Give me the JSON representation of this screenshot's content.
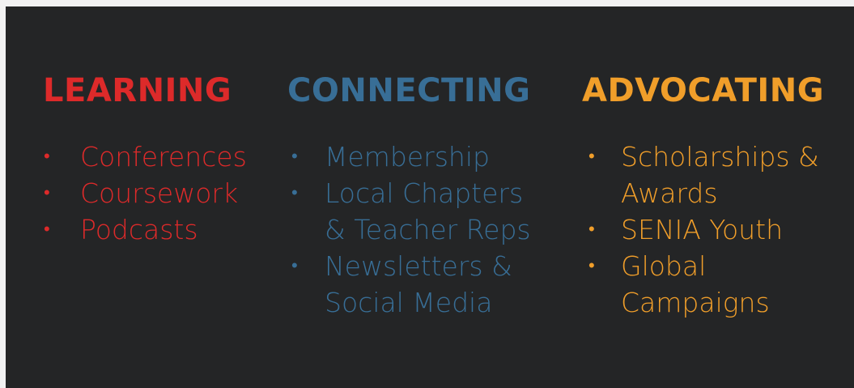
{
  "colors": {
    "background": "#242526",
    "page": "#f2f2f2",
    "learning": "#dd2a2a",
    "connecting": "#386e96",
    "advocating": "#f09e2a"
  },
  "columns": [
    {
      "heading": "LEARNING",
      "items": [
        [
          "Conferences"
        ],
        [
          "Coursework"
        ],
        [
          "Podcasts"
        ]
      ]
    },
    {
      "heading": "CONNECTING",
      "items": [
        [
          "Membership"
        ],
        [
          "Local Chapters",
          "& Teacher Reps"
        ],
        [
          "Newsletters &",
          "Social Media"
        ]
      ]
    },
    {
      "heading": "ADVOCATING",
      "items": [
        [
          "Scholarships &",
          "Awards"
        ],
        [
          "SENIA Youth"
        ],
        [
          "Global",
          "Campaigns"
        ]
      ]
    }
  ]
}
